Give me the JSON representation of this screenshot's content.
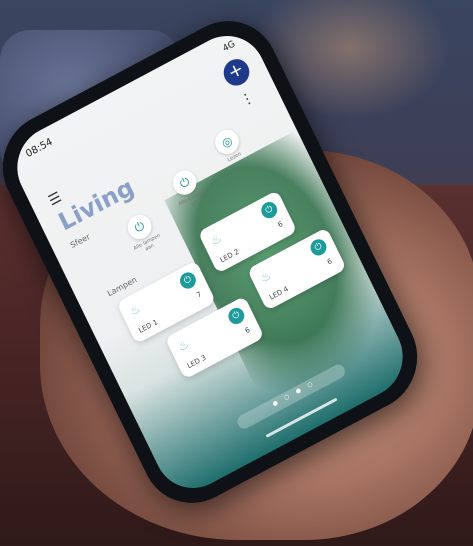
{
  "status": {
    "time": "08:54",
    "right": "4G"
  },
  "header": {
    "room": "Living",
    "menu_icon": "hamburger-icon",
    "more_icon": "kebab-icon",
    "add_icon": "plus-icon"
  },
  "sections": {
    "scenes": "Sfeer",
    "lights": "Lampen"
  },
  "scenes": [
    {
      "label": "Alle lampen aan",
      "icon": "power-icon"
    },
    {
      "label": "Alle lampen uit",
      "icon": "power-icon"
    },
    {
      "label": "Lezen",
      "icon": "scene-icon"
    }
  ],
  "lights": [
    {
      "label": "LED 1",
      "value": "7"
    },
    {
      "label": "LED 2",
      "value": "6"
    },
    {
      "label": "LED 3",
      "value": "6"
    },
    {
      "label": "LED 4",
      "value": "6"
    }
  ],
  "colors": {
    "accent": "#1d9a9a",
    "fab": "#1e3a8a",
    "title": "#8aa0c6"
  }
}
